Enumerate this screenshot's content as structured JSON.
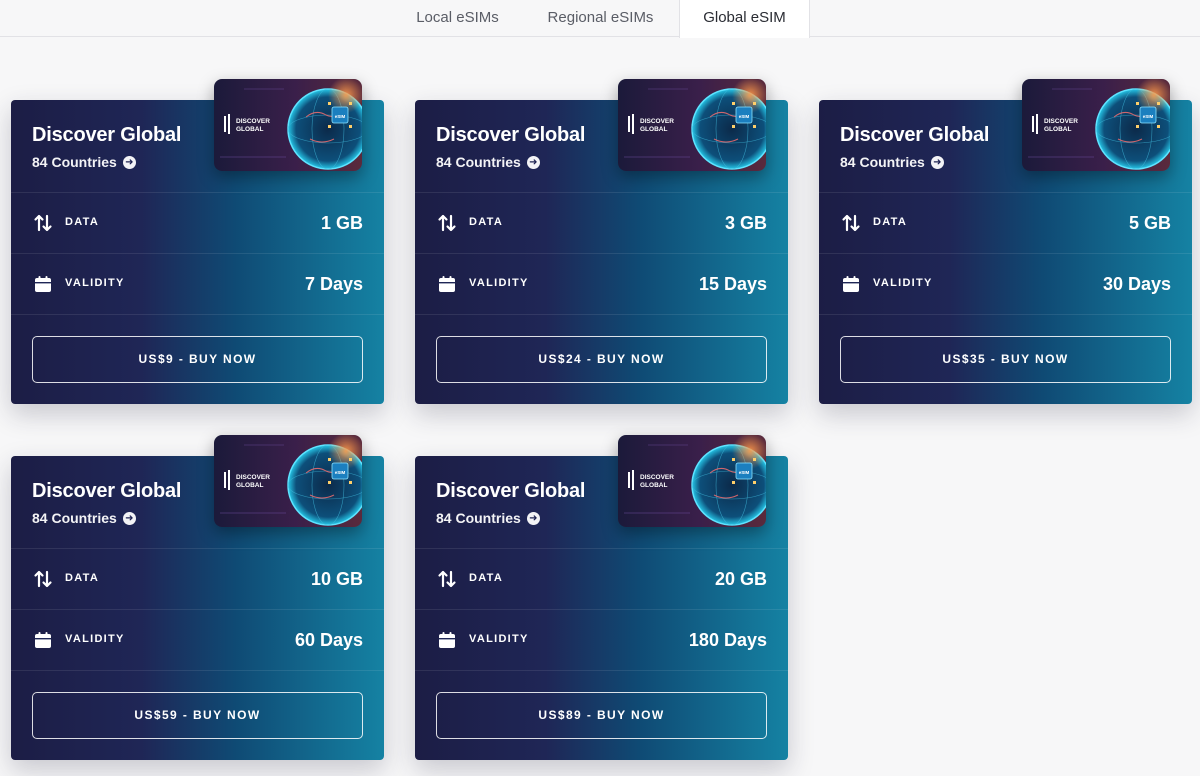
{
  "tabs": [
    {
      "label": "Local eSIMs",
      "active": false
    },
    {
      "label": "Regional eSIMs",
      "active": false
    },
    {
      "label": "Global eSIM",
      "active": true
    }
  ],
  "labels": {
    "data": "DATA",
    "validity": "VALIDITY"
  },
  "icons": {
    "data": "up-down-arrows-icon",
    "validity": "calendar-icon",
    "countries": "arrow-right-circle-icon"
  },
  "sim_card": {
    "brand_line1": "DISCOVER",
    "brand_line2": "GLOBAL",
    "chip_text": "eSIM"
  },
  "colors": {
    "card_gradient_start": "#1c1d45",
    "card_gradient_end": "#1582a3",
    "active_tab_bg": "#ffffff"
  },
  "plans": [
    {
      "title": "Discover Global",
      "countries": "84 Countries",
      "data": "1 GB",
      "validity": "7 Days",
      "button": "US$9 - BUY NOW"
    },
    {
      "title": "Discover Global",
      "countries": "84 Countries",
      "data": "3 GB",
      "validity": "15 Days",
      "button": "US$24 - BUY NOW"
    },
    {
      "title": "Discover Global",
      "countries": "84 Countries",
      "data": "5 GB",
      "validity": "30 Days",
      "button": "US$35 - BUY NOW"
    },
    {
      "title": "Discover Global",
      "countries": "84 Countries",
      "data": "10 GB",
      "validity": "60 Days",
      "button": "US$59 - BUY NOW"
    },
    {
      "title": "Discover Global",
      "countries": "84 Countries",
      "data": "20 GB",
      "validity": "180 Days",
      "button": "US$89 - BUY NOW"
    }
  ]
}
